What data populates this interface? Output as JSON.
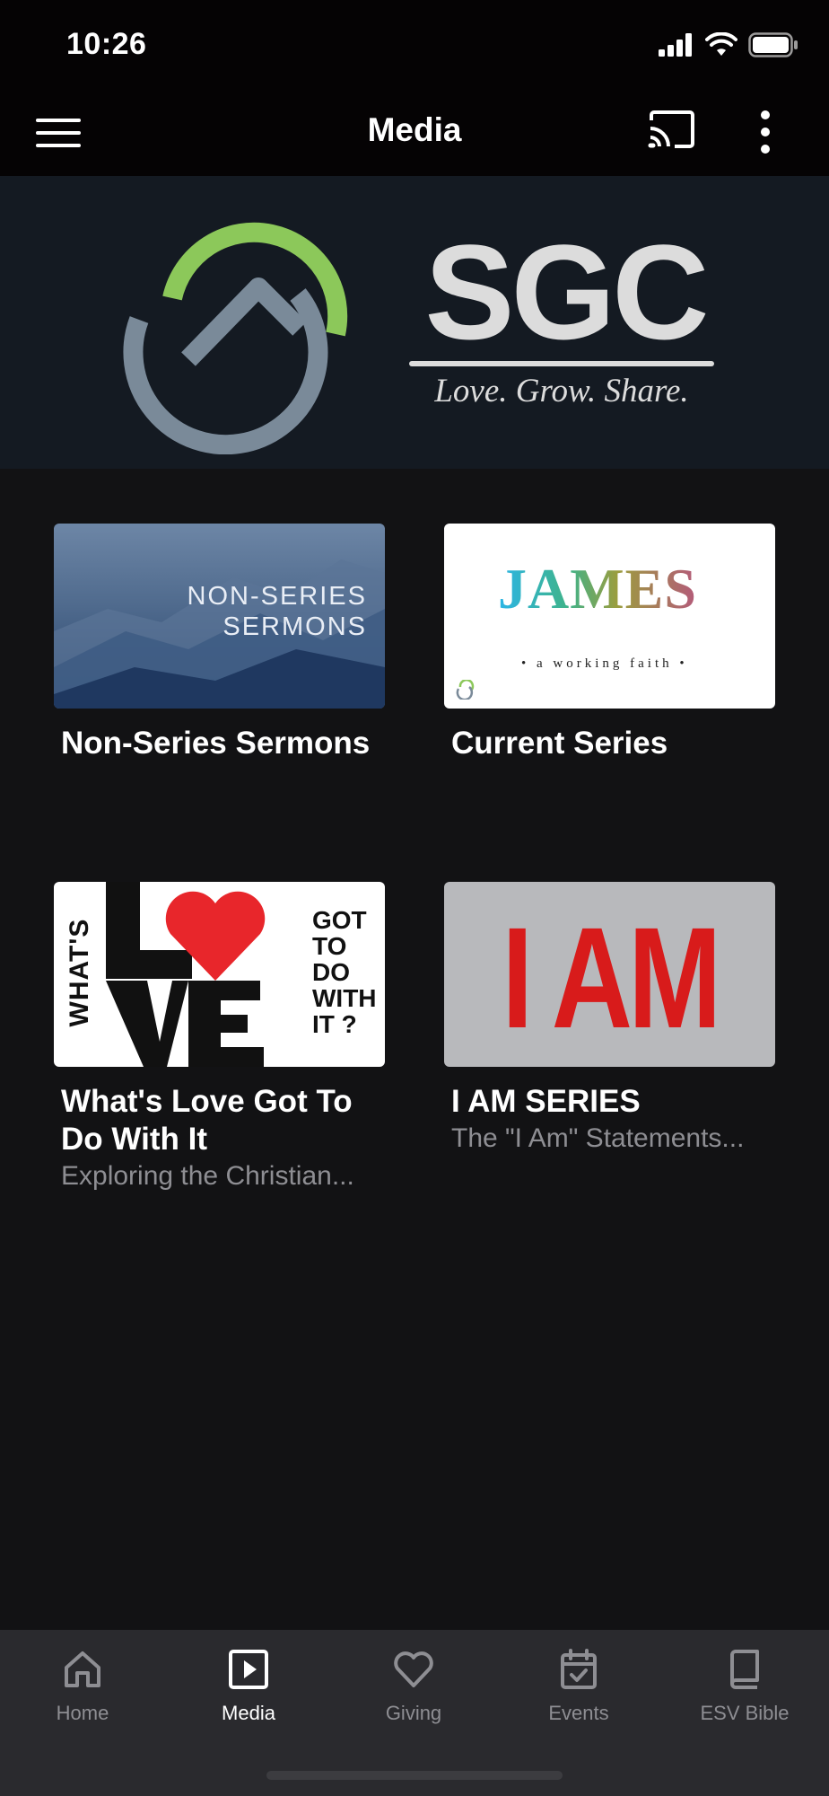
{
  "status_bar": {
    "time": "10:26"
  },
  "app_bar": {
    "title": "Media"
  },
  "banner": {
    "brand": "SGC",
    "tagline": "Love. Grow. Share."
  },
  "thumbnails": {
    "non_series_line1": "NON-SERIES",
    "non_series_line2": "SERMONS",
    "james_title": "JAMES",
    "james_subtitle": "• a working faith •",
    "love_left": "WHAT'S",
    "love_right_1": "GOT",
    "love_right_2": "TO",
    "love_right_3": "DO",
    "love_right_4": "WITH",
    "love_right_5": "IT ?",
    "iam_title": "I AM"
  },
  "cards": [
    {
      "title": "Non-Series Sermons",
      "subtitle": ""
    },
    {
      "title": "Current Series",
      "subtitle": ""
    },
    {
      "title": "What's Love Got To Do With It",
      "subtitle": "Exploring the Christian..."
    },
    {
      "title": "I AM SERIES",
      "subtitle": "The \"I Am\" Statements..."
    }
  ],
  "bottom_nav": {
    "items": [
      {
        "label": "Home",
        "icon": "home-icon",
        "active": false
      },
      {
        "label": "Media",
        "icon": "media-play-icon",
        "active": true
      },
      {
        "label": "Giving",
        "icon": "heart-icon",
        "active": false
      },
      {
        "label": "Events",
        "icon": "calendar-check-icon",
        "active": false
      },
      {
        "label": "ESV Bible",
        "icon": "book-icon",
        "active": false
      }
    ]
  },
  "colors": {
    "background": "#121214",
    "top_bar": "#050304",
    "banner": "#141a22",
    "logo_green": "#8cc85a",
    "logo_gray": "#7a8a99",
    "nav_background": "#2a2a2e",
    "inactive": "#8e8e93",
    "iam_red": "#d81b1b",
    "heart_red": "#e8262b"
  }
}
